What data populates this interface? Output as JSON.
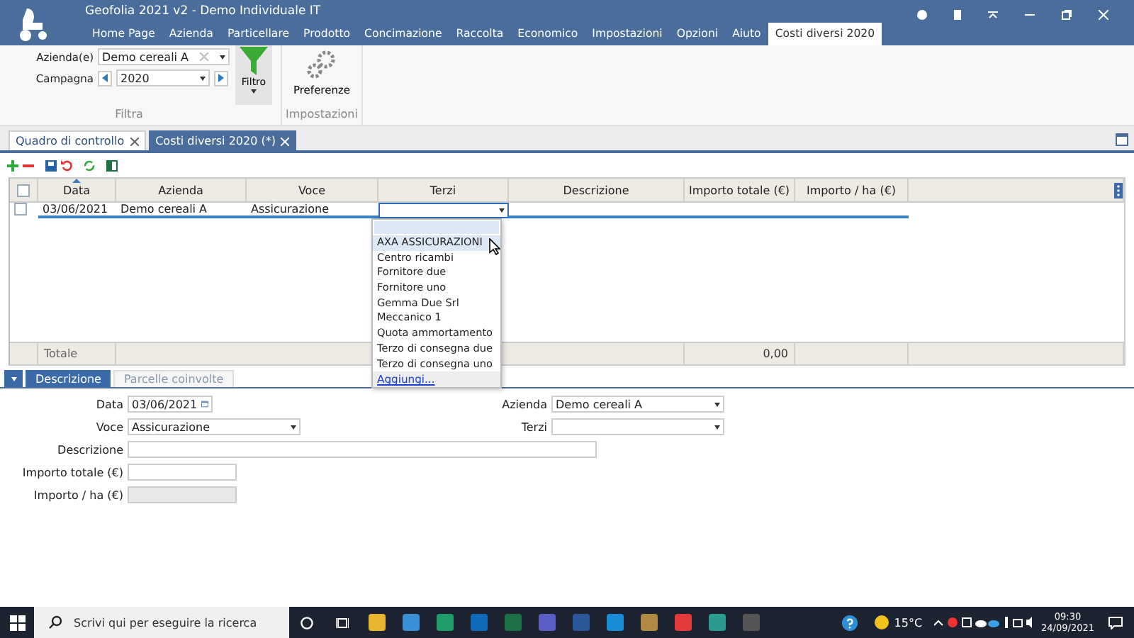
{
  "window": {
    "title": "Geofolia 2021 v2 - Demo Individuale IT"
  },
  "menu": [
    {
      "label": "Home Page",
      "selected": false
    },
    {
      "label": "Azienda",
      "selected": false
    },
    {
      "label": "Particellare",
      "selected": false
    },
    {
      "label": "Prodotto",
      "selected": false
    },
    {
      "label": "Concimazione",
      "selected": false
    },
    {
      "label": "Raccolta",
      "selected": false
    },
    {
      "label": "Economico",
      "selected": false
    },
    {
      "label": "Impostazioni",
      "selected": false
    },
    {
      "label": "Opzioni",
      "selected": false
    },
    {
      "label": "Aiuto",
      "selected": false
    },
    {
      "label": "Costi diversi 2020",
      "selected": true
    }
  ],
  "ribbon": {
    "azienda": {
      "label": "Azienda(e)",
      "value": "Demo cereali A"
    },
    "campagna": {
      "label": "Campagna",
      "value": "2020"
    },
    "filter_button": "Filtro",
    "filter_group": "Filtra",
    "preferences_button": "Preferenze",
    "settings_group": "Impostazioni"
  },
  "doc_tabs": [
    {
      "label": "Quadro di controllo",
      "selected": false
    },
    {
      "label": "Costi diversi 2020 (*)",
      "selected": true
    }
  ],
  "table": {
    "all_checked": false,
    "columns": [
      {
        "label": "Data",
        "sorted": true
      },
      {
        "label": "Azienda",
        "sorted": false
      },
      {
        "label": "Voce",
        "sorted": false
      },
      {
        "label": "Terzi",
        "sorted": false
      },
      {
        "label": "Descrizione",
        "sorted": false
      },
      {
        "label": "Importo totale (€)",
        "sorted": false
      },
      {
        "label": "Importo / ha (€)",
        "sorted": false
      }
    ],
    "rows": [
      {
        "checked": false,
        "cells": [
          "03/06/2021",
          "Demo cereali A",
          "Assicurazione",
          "",
          "",
          "",
          ""
        ]
      }
    ],
    "footer": {
      "label": "Totale",
      "total": "0,00"
    }
  },
  "dropdown": {
    "items": [
      {
        "label": "AXA ASSICURAZIONI",
        "selected": true
      },
      {
        "label": "Centro ricambi",
        "selected": false
      },
      {
        "label": "Fornitore due",
        "selected": false
      },
      {
        "label": "Fornitore uno",
        "selected": false
      },
      {
        "label": "Gemma Due Srl",
        "selected": false
      },
      {
        "label": "Meccanico 1",
        "selected": false
      },
      {
        "label": "Quota ammortamento",
        "selected": false
      },
      {
        "label": "Terzo di consegna due",
        "selected": false
      },
      {
        "label": "Terzo di consegna uno",
        "selected": false
      }
    ],
    "add_link": "Aggiungi..."
  },
  "detail_tabs": [
    {
      "label": "Descrizione",
      "selected": true
    },
    {
      "label": "Parcelle coinvolte",
      "selected": false
    }
  ],
  "form": {
    "rows": [
      [
        {
          "label": "Data",
          "value": "03/06/2021",
          "kind": "date",
          "disabled": false
        },
        {
          "label": "Azienda",
          "value": "Demo cereali A",
          "kind": "select",
          "disabled": false
        }
      ],
      [
        {
          "label": "Voce",
          "value": "Assicurazione",
          "kind": "select",
          "disabled": false
        },
        {
          "label": "Terzi",
          "kind": "select",
          "disabled": false
        }
      ],
      [
        {
          "label": "Descrizione",
          "kind": "wide",
          "disabled": false
        }
      ],
      [
        {
          "label": "Importo totale (€)",
          "kind": "short",
          "disabled": false
        }
      ],
      [
        {
          "label": "Importo / ha (€)",
          "kind": "short",
          "disabled": true
        }
      ]
    ]
  },
  "taskbar": {
    "search_placeholder": "Scrivi qui per eseguire la ricerca",
    "temperature": "15°C",
    "time": "09:30",
    "date": "24/09/2021"
  }
}
